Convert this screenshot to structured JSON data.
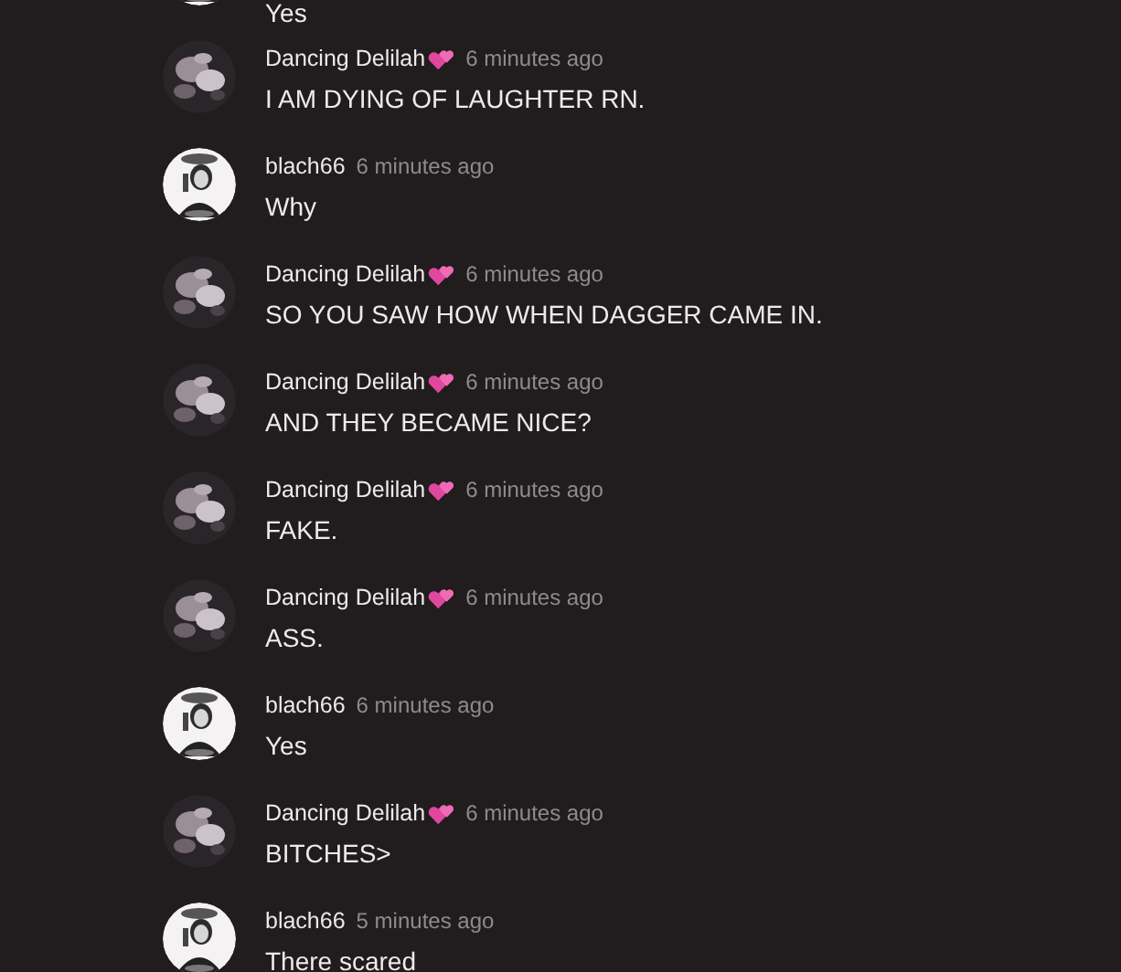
{
  "comments": [
    {
      "message": "Yes",
      "hearts": false
    },
    {
      "author": "Dancing Delilah",
      "time": "6 minutes ago",
      "message": "I AM DYING OF LAUGHTER RN.",
      "hearts": true
    },
    {
      "author": "blach66",
      "time": "6 minutes ago",
      "message": "Why",
      "hearts": false
    },
    {
      "author": "Dancing Delilah",
      "time": "6 minutes ago",
      "message": "SO YOU SAW HOW WHEN DAGGER CAME IN.",
      "hearts": true
    },
    {
      "author": "Dancing Delilah",
      "time": "6 minutes ago",
      "message": "AND THEY BECAME NICE?",
      "hearts": true
    },
    {
      "author": "Dancing Delilah",
      "time": "6 minutes ago",
      "message": "FAKE.",
      "hearts": true
    },
    {
      "author": "Dancing Delilah",
      "time": "6 minutes ago",
      "message": "ASS.",
      "hearts": true
    },
    {
      "author": "blach66",
      "time": "6 minutes ago",
      "message": "Yes",
      "hearts": false
    },
    {
      "author": "Dancing Delilah",
      "time": "6 minutes ago",
      "message": "BITCHES>",
      "hearts": true
    },
    {
      "author": "blach66",
      "time": "5 minutes ago",
      "message": "There scared",
      "hearts": false
    }
  ]
}
